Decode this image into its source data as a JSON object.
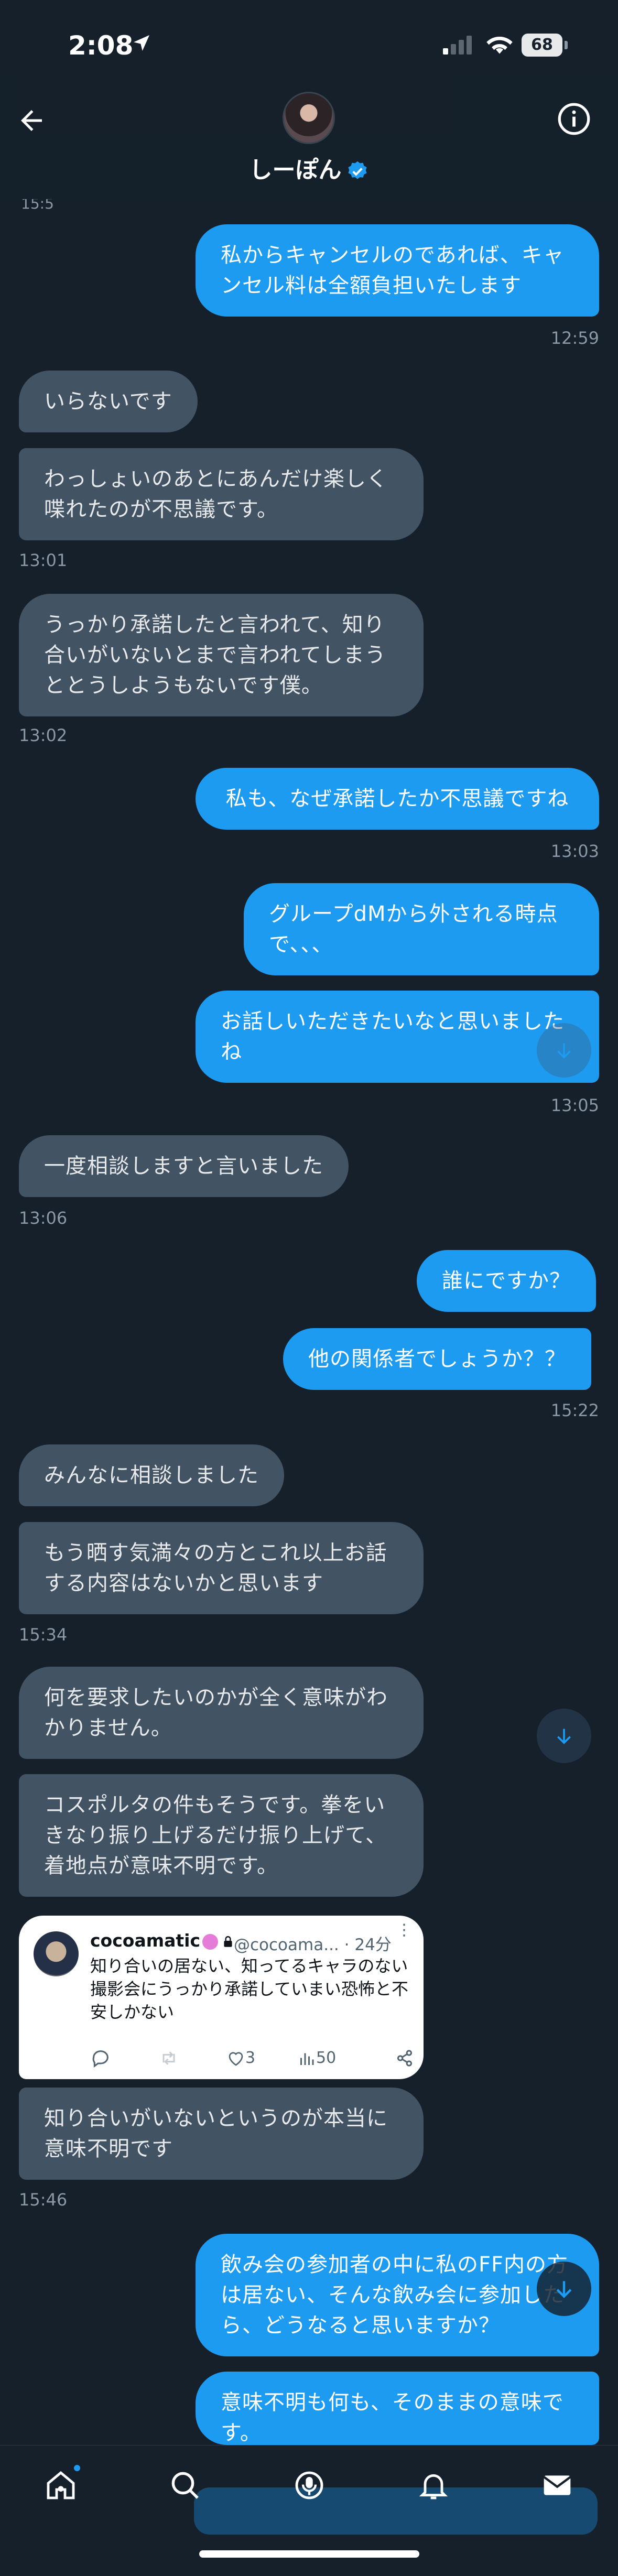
{
  "status_bar": {
    "time": "2:08",
    "battery": "68"
  },
  "header": {
    "name": "しーぽん"
  },
  "partial_timestamp": "15:5",
  "messages": [
    {
      "text": "私からキャンセルのであれば、キャンセル料は全額負担いたします"
    },
    {
      "text": "いらないです"
    },
    {
      "text": "わっしょいのあとにあんだけ楽しく喋れたのが不思議です。"
    },
    {
      "text": "うっかり承諾したと言われて、知り合いがいないとまで言われてしまうととうしようもないです僕。"
    },
    {
      "text": "私も、なぜ承諾したか不思議ですね"
    },
    {
      "text": "グループdMから外される時点で、、、"
    },
    {
      "text": "お話しいただきたいなと思いましたね"
    },
    {
      "text": "一度相談しますと言いました"
    },
    {
      "text": "誰にですか？"
    },
    {
      "text": "他の関係者でしょうか？？"
    },
    {
      "text": "みんなに相談しました"
    },
    {
      "text": "もう晒す気満々の方とこれ以上お話する内容はないかと思います"
    },
    {
      "text": "何を要求したいのかが全く意味がわかりません。"
    },
    {
      "text": "コスポルタの件もそうです。拳をいきなり振り上げるだけ振り上げて、着地点が意味不明です。"
    },
    {
      "text": "知り合いがいないというのが本当に意味不明です"
    },
    {
      "text": "飲み会の参加者の中に私のFF内の方は居ない、そんな飲み会に参加したら、どうなると思いますか？"
    },
    {
      "text": "意味不明も何も、そのままの意味です。"
    }
  ],
  "timestamps": [
    "12:59",
    "13:01",
    "13:02",
    "13:03",
    "13:05",
    "13:06",
    "15:22",
    "15:34",
    "15:46"
  ],
  "tweet": {
    "name": "cocoamatic",
    "handle": "@cocoama...",
    "age": "· 24分",
    "text": "知り合いの居ない、知ってるキャラのない撮影会にうっかり承諾していまい恐怖と不安しかない",
    "likes": "3",
    "views": "50"
  },
  "colors": {
    "background": "#15202b",
    "outgoing": "#1d9bf0",
    "incoming": "#425364",
    "timestamp": "#8b98a5"
  }
}
